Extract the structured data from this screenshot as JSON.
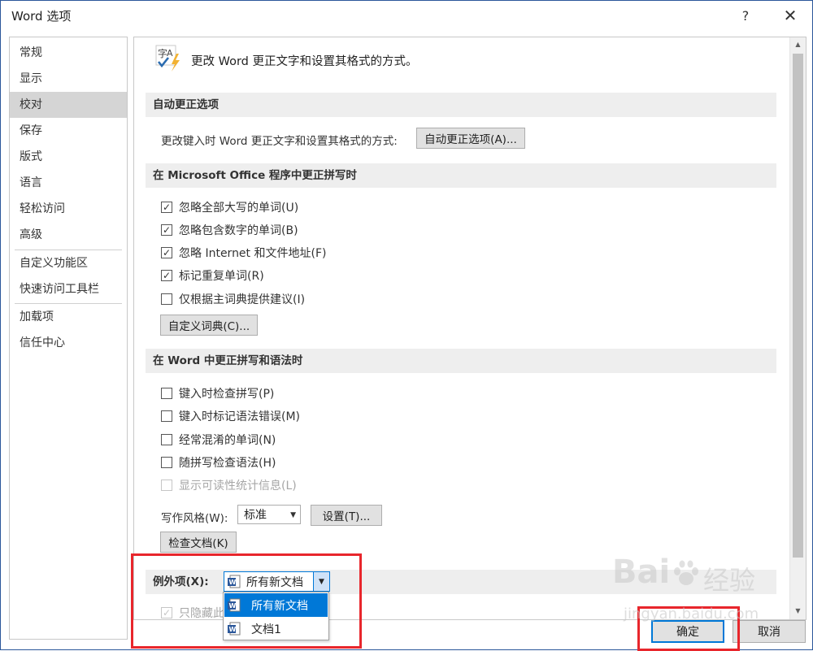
{
  "window": {
    "title": "Word 选项",
    "help_glyph": "?",
    "close_glyph": "✕"
  },
  "sidebar": {
    "items": [
      {
        "label": "常规"
      },
      {
        "label": "显示"
      },
      {
        "label": "校对"
      },
      {
        "label": "保存"
      },
      {
        "label": "版式"
      },
      {
        "label": "语言"
      },
      {
        "label": "轻松访问"
      },
      {
        "label": "高级"
      },
      {
        "label": "自定义功能区"
      },
      {
        "label": "快速访问工具栏"
      },
      {
        "label": "加载项"
      },
      {
        "label": "信任中心"
      }
    ],
    "active_index": 2
  },
  "content": {
    "intro": "更改 Word 更正文字和设置其格式的方式。",
    "autocorrect": {
      "header": "自动更正选项",
      "label": "更改键入时 Word 更正文字和设置其格式的方式:",
      "button": "自动更正选项(A)..."
    },
    "office_spelling": {
      "header": "在 Microsoft Office 程序中更正拼写时",
      "options": [
        {
          "label": "忽略全部大写的单词(U)",
          "checked": true
        },
        {
          "label": "忽略包含数字的单词(B)",
          "checked": true
        },
        {
          "label": "忽略 Internet 和文件地址(F)",
          "checked": true
        },
        {
          "label": "标记重复单词(R)",
          "checked": true
        },
        {
          "label": "仅根据主词典提供建议(I)",
          "checked": false
        }
      ],
      "dictionary_button": "自定义词典(C)..."
    },
    "word_spelling": {
      "header": "在 Word 中更正拼写和语法时",
      "options": [
        {
          "label": "键入时检查拼写(P)",
          "checked": false
        },
        {
          "label": "键入时标记语法错误(M)",
          "checked": false
        },
        {
          "label": "经常混淆的单词(N)",
          "checked": false
        },
        {
          "label": "随拼写检查语法(H)",
          "checked": false
        },
        {
          "label": "显示可读性统计信息(L)",
          "checked": false,
          "disabled": true
        }
      ],
      "writing_style_label": "写作风格(W):",
      "writing_style_value": "标准",
      "settings_button": "设置(T)...",
      "recheck_button": "检查文档(K)"
    },
    "exceptions": {
      "label": "例外项(X):",
      "selected": "所有新文档",
      "hidden_option_partial": "只隐藏此"
    }
  },
  "dropdown": {
    "options": [
      {
        "label": "所有新文档",
        "selected": true
      },
      {
        "label": "文档1",
        "selected": false
      }
    ]
  },
  "footer": {
    "ok": "确定",
    "cancel": "取消"
  },
  "watermark": {
    "brand": "Bai",
    "brand2": "经验",
    "url": "jingyan.baidu.com"
  },
  "colors": {
    "accent": "#0078d7",
    "highlight": "#e8262c",
    "title_border": "#2b579a"
  }
}
